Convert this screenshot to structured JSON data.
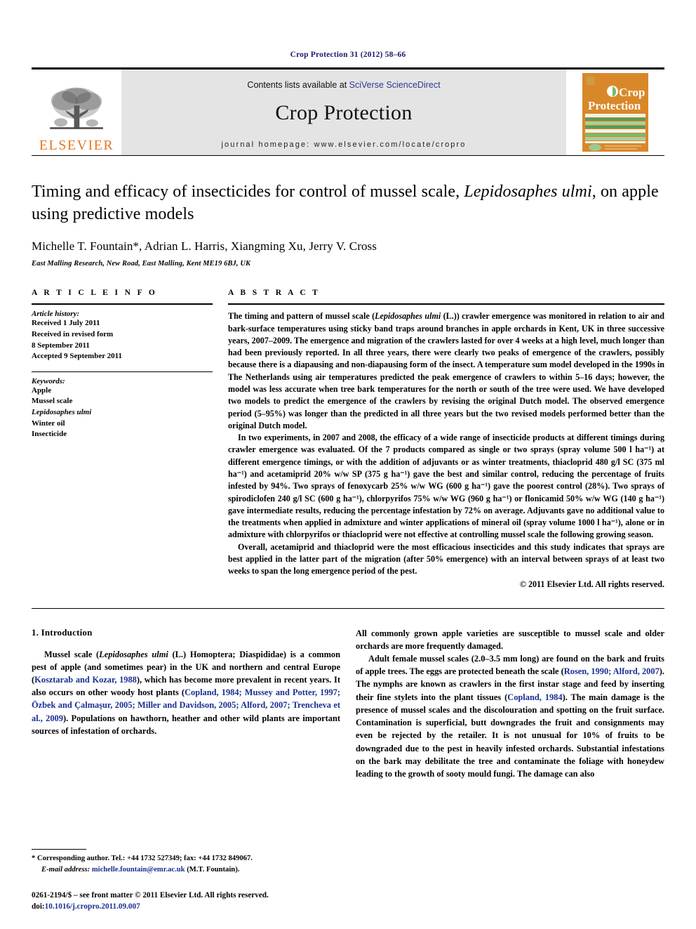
{
  "running_head": "Crop Protection 31 (2012) 58–66",
  "masthead": {
    "publisher_name": "ELSEVIER",
    "contents_prefix": "Contents lists available at ",
    "contents_link": "SciVerse ScienceDirect",
    "journal_title": "Crop Protection",
    "homepage": "journal homepage: www.elsevier.com/locate/cropro",
    "cover_title_line1": "Crop",
    "cover_title_line2": "Protection"
  },
  "article": {
    "title_part1": "Timing and efficacy of insecticides for control of mussel scale, ",
    "title_species": "Lepidosaphes ulmi",
    "title_part2": ",",
    "title_line2": "on apple using predictive models",
    "authors": "Michelle T. Fountain*, Adrian L. Harris, Xiangming Xu, Jerry V. Cross",
    "affiliation": "East Malling Research, New Road, East Malling, Kent ME19 6BJ, UK"
  },
  "article_info": {
    "heading": "A R T I C L E   I N F O",
    "history_label": "Article history:",
    "history": [
      "Received 1 July 2011",
      "Received in revised form",
      "8 September 2011",
      "Accepted 9 September 2011"
    ],
    "keywords_label": "Keywords:",
    "keywords": [
      {
        "text": "Apple",
        "italic": false
      },
      {
        "text": "Mussel scale",
        "italic": false
      },
      {
        "text": "Lepidosaphes ulmi",
        "italic": true
      },
      {
        "text": "Winter oil",
        "italic": false
      },
      {
        "text": "Insecticide",
        "italic": false
      }
    ]
  },
  "abstract": {
    "heading": "A B S T R A C T",
    "paragraph1_a": "The timing and pattern of mussel scale (",
    "paragraph1_species": "Lepidosaphes ulmi",
    "paragraph1_b": " (L.)) crawler emergence was monitored in relation to air and bark-surface temperatures using sticky band traps around branches in apple orchards in Kent, UK in three successive years, 2007–2009. The emergence and migration of the crawlers lasted for over 4 weeks at a high level, much longer than had been previously reported. In all three years, there were clearly two peaks of emergence of the crawlers, possibly because there is a diapausing and non-diapausing form of the insect. A temperature sum model developed in the 1990s in The Netherlands using air temperatures predicted the peak emergence of crawlers to within 5–16 days; however, the model was less accurate when tree bark temperatures for the north or south of the tree were used. We have developed two models to predict the emergence of the crawlers by revising the original Dutch model. The observed emergence period (5–95%) was longer than the predicted in all three years but the two revised models performed better than the original Dutch model.",
    "paragraph2": "In two experiments, in 2007 and 2008, the efficacy of a wide range of insecticide products at different timings during crawler emergence was evaluated. Of the 7 products compared as single or two sprays (spray volume 500 l ha⁻¹) at different emergence timings, or with the addition of adjuvants or as winter treatments, thiacloprid 480 g/l SC (375 ml ha⁻¹) and acetamiprid 20% w/w SP (375 g ha⁻¹) gave the best and similar control, reducing the percentage of fruits infested by 94%. Two sprays of fenoxycarb 25% w/w WG (600 g ha⁻¹) gave the poorest control (28%). Two sprays of spirodiclofen 240 g/l SC (600 g ha⁻¹), chlorpyrifos 75% w/w WG (960 g ha⁻¹) or flonicamid 50% w/w WG (140 g ha⁻¹) gave intermediate results, reducing the percentage infestation by 72% on average. Adjuvants gave no additional value to the treatments when applied in admixture and winter applications of mineral oil (spray volume 1000 l ha⁻¹), alone or in admixture with chlorpyrifos or thiacloprid were not effective at controlling mussel scale the following growing season.",
    "paragraph3": "Overall, acetamiprid and thiacloprid were the most efficacious insecticides and this study indicates that sprays are best applied in the latter part of the migration (after 50% emergence) with an interval between sprays of at least two weeks to span the long emergence period of the pest.",
    "copyright": "© 2011 Elsevier Ltd. All rights reserved."
  },
  "introduction": {
    "heading": "1. Introduction",
    "left_p1_a": "Mussel scale (",
    "left_p1_species": "Lepidosaphes ulmi",
    "left_p1_b": " (L.) Homoptera; Diaspididae) is a common pest of apple (and sometimes pear) in the UK and northern and central Europe (",
    "left_p1_ref1": "Kosztarab and Kozar, 1988",
    "left_p1_c": "), which has become more prevalent in recent years. It also occurs on other woody host plants (",
    "left_p1_ref2": "Copland, 1984; Mussey and Potter, 1997; Özbek and Çalmaşur, 2005; Miller and Davidson, 2005; Alford, 2007; Trencheva et al., 2009",
    "left_p1_d": "). Populations on hawthorn, heather and other wild plants are important sources of infestation of orchards.",
    "right_p1": "All commonly grown apple varieties are susceptible to mussel scale and older orchards are more frequently damaged.",
    "right_p2_a": "Adult female mussel scales (2.0–3.5 mm long) are found on the bark and fruits of apple trees. The eggs are protected beneath the scale (",
    "right_p2_ref1": "Rosen, 1990; Alford, 2007",
    "right_p2_b": "). The nymphs are known as crawlers in the first instar stage and feed by inserting their fine stylets into the plant tissues (",
    "right_p2_ref2": "Copland, 1984",
    "right_p2_c": "). The main damage is the presence of mussel scales and the discolouration and spotting on the fruit surface. Contamination is superficial, butt downgrades the fruit and consignments may even be rejected by the retailer. It is not unusual for 10% of fruits to be downgraded due to the pest in heavily infested orchards. Substantial infestations on the bark may debilitate the tree and contaminate the foliage with honeydew leading to the growth of sooty mould fungi. The damage can also"
  },
  "footnote": {
    "corresponding_marker": "*",
    "corresponding": " Corresponding author. Tel.: +44 1732 527349; fax: +44 1732 849067.",
    "email_label": "E-mail address:",
    "email": "michelle.fountain@emr.ac.uk",
    "email_suffix": " (M.T. Fountain).",
    "issn_line": "0261-2194/$ – see front matter © 2011 Elsevier Ltd. All rights reserved.",
    "doi_label": "doi:",
    "doi": "10.1016/j.cropro.2011.09.007"
  },
  "colors": {
    "link_blue": "#1a2f8f",
    "elsevier_orange": "#e87722",
    "masthead_grey": "#e4e4e4",
    "cover_orange": "#d98829",
    "cover_green": "#5a9b54"
  }
}
